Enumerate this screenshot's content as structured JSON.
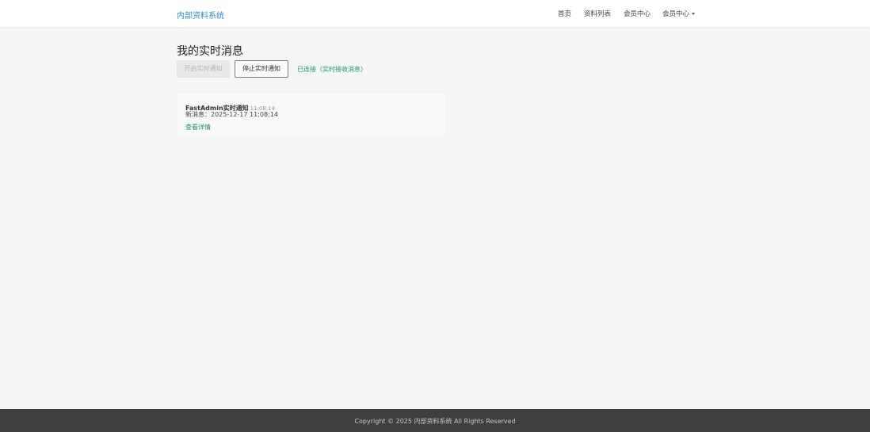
{
  "navbar": {
    "brand": "内部资料系统",
    "items": [
      {
        "label": "首页"
      },
      {
        "label": "资料列表"
      },
      {
        "label": "会员中心"
      },
      {
        "label": "会员中心",
        "dropdown": true
      }
    ]
  },
  "page": {
    "title": "我的实时消息"
  },
  "controls": {
    "start_label": "开启实时通知",
    "start_disabled": true,
    "stop_label": "停止实时通知",
    "status_text": "已连接（实时接收消息）"
  },
  "messages": [
    {
      "title": "FastAdmin实时通知",
      "time": "11:08:14",
      "body": "新消息：2025-12-17 11:08:14",
      "link_label": "查看详情"
    }
  ],
  "footer": {
    "copyright": "Copyright © 2025 内部资料系统 All Rights Reserved"
  },
  "colors": {
    "brand": "#2c8fd6",
    "status": "#1f9a6e",
    "link": "#1f8f6b",
    "footer_bg": "#3f3f3f",
    "page_bg": "#f4f5f6"
  },
  "icons": {
    "dropdown": "caret-down-icon"
  }
}
